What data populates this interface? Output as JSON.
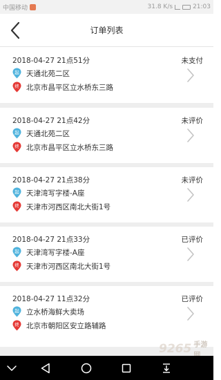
{
  "status_bar": {
    "carrier": "中国移动",
    "speed": "31.8 K/s",
    "time": "21:03"
  },
  "header": {
    "title": "订单列表"
  },
  "orders": [
    {
      "time": "2018-04-27 21点51分",
      "status": "未支付",
      "start_badge": "起",
      "start": "天通北苑二区",
      "end_badge": "终",
      "end": "北京市昌平区立水桥东三路"
    },
    {
      "time": "2018-04-27 21点42分",
      "status": "未评价",
      "start_badge": "起",
      "start": "天通北苑二区",
      "end_badge": "终",
      "end": "北京市昌平区立水桥东三路"
    },
    {
      "time": "2018-04-27 21点38分",
      "status": "未评价",
      "start_badge": "起",
      "start": "天津湾写字楼-A座",
      "end_badge": "终",
      "end": "天津市河西区南北大街1号"
    },
    {
      "time": "2018-04-27 21点33分",
      "status": "已评价",
      "start_badge": "起",
      "start": "天津湾写字楼-A座",
      "end_badge": "终",
      "end": "天津市河西区南北大街1号"
    },
    {
      "time": "2018-04-27 11点32分",
      "status": "已评价",
      "start_badge": "起",
      "start": "立水桥海鲜大卖场",
      "end_badge": "终",
      "end": "北京市朝阳区安立路辅路"
    }
  ],
  "watermark": {
    "number": "9265",
    "text": "手游网"
  },
  "colors": {
    "start_pin": "#4fb3dd",
    "end_pin": "#e53935",
    "divider": "#eeeeee",
    "nav_bar_bottom": "#000000"
  }
}
